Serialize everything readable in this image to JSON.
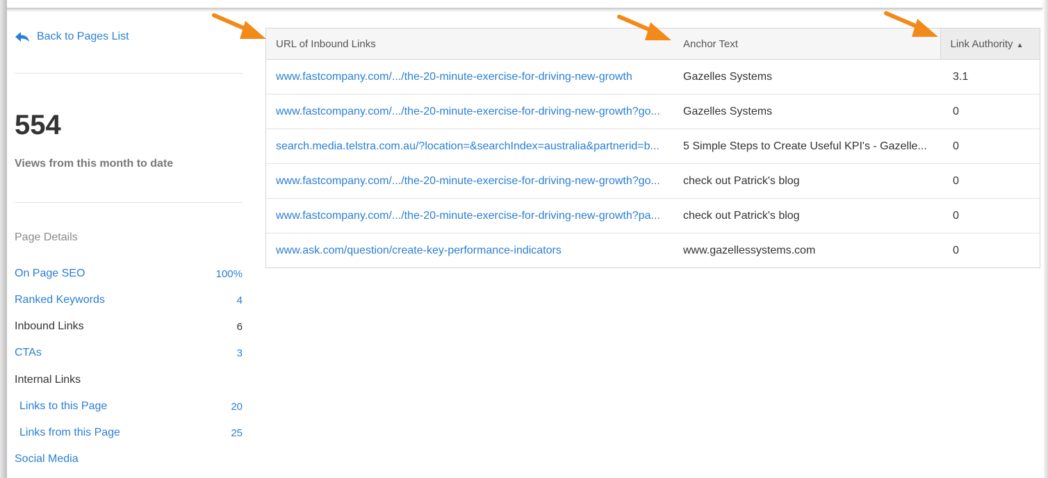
{
  "sidebar": {
    "back_label": "Back to Pages List",
    "views_count": "554",
    "views_caption": "Views from this month to date",
    "details_title": "Page Details",
    "items": [
      {
        "label": "On Page SEO",
        "value": "100%"
      },
      {
        "label": "Ranked Keywords",
        "value": "4"
      },
      {
        "label": "Inbound Links",
        "value": "6"
      },
      {
        "label": "CTAs",
        "value": "3"
      },
      {
        "label": "Internal Links",
        "value": ""
      },
      {
        "label": "Links to this Page",
        "value": "20"
      },
      {
        "label": "Links from this Page",
        "value": "25"
      },
      {
        "label": "Social Media",
        "value": ""
      }
    ]
  },
  "table": {
    "headers": [
      "URL of Inbound Links",
      "Anchor Text",
      "Link Authority"
    ],
    "rows": [
      {
        "url": "www.fastcompany.com/.../the-20-minute-exercise-for-driving-new-growth",
        "anchor": "Gazelles Systems",
        "authority": "3.1"
      },
      {
        "url": "www.fastcompany.com/.../the-20-minute-exercise-for-driving-new-growth?go...",
        "anchor": "Gazelles Systems",
        "authority": "0"
      },
      {
        "url": "search.media.telstra.com.au/?location=&searchIndex=australia&partnerid=b...",
        "anchor": "5 Simple Steps to Create Useful KPI's - Gazelle...",
        "authority": "0"
      },
      {
        "url": "www.fastcompany.com/.../the-20-minute-exercise-for-driving-new-growth?go...",
        "anchor": "check out Patrick's blog",
        "authority": "0"
      },
      {
        "url": "www.fastcompany.com/.../the-20-minute-exercise-for-driving-new-growth?pa...",
        "anchor": "check out Patrick's blog",
        "authority": "0"
      },
      {
        "url": "www.ask.com/question/create-key-performance-indicators",
        "anchor": "www.gazellessystems.com",
        "authority": "0"
      }
    ]
  },
  "colors": {
    "link": "#2a7fd4",
    "annotation_arrow": "#f28a1a"
  }
}
